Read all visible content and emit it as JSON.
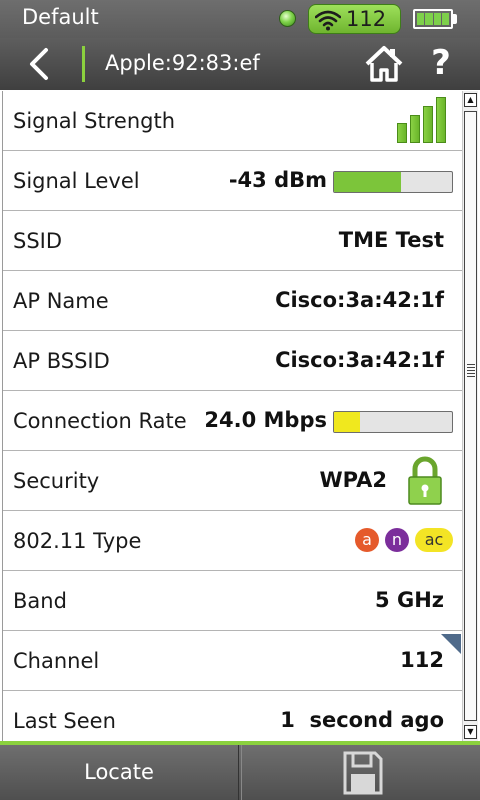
{
  "status_bar": {
    "profile": "Default",
    "wifi_count": "112",
    "battery_segments": 4,
    "led_color": "#7fd34a"
  },
  "header": {
    "title": "Apple:92:83:ef",
    "back_icon": "chevron-left-icon",
    "home_icon": "home-icon",
    "help_label": "?"
  },
  "details": {
    "signal_strength": {
      "label": "Signal Strength",
      "bars_lit": 4,
      "bars_total": 4
    },
    "signal_level": {
      "label": "Signal Level",
      "value": "-43 dBm",
      "meter_fraction": 0.57,
      "meter_color": "#7cc53a"
    },
    "ssid": {
      "label": "SSID",
      "value": "TME Test"
    },
    "ap_name": {
      "label": "AP Name",
      "value": "Cisco:3a:42:1f"
    },
    "ap_bssid": {
      "label": "AP BSSID",
      "value": "Cisco:3a:42:1f"
    },
    "connection_rate": {
      "label": "Connection Rate",
      "value": "24.0 Mbps",
      "meter_fraction": 0.22,
      "meter_color": "#f0e81e"
    },
    "security": {
      "label": "Security",
      "value": "WPA2",
      "icon": "lock-icon"
    },
    "type_80211": {
      "label": "802.11 Type",
      "badges": [
        "a",
        "n",
        "ac"
      ]
    },
    "band": {
      "label": "Band",
      "value": "5 GHz"
    },
    "channel": {
      "label": "Channel",
      "value": "112"
    },
    "last_seen": {
      "label": "Last Seen",
      "value": "1  second ago"
    }
  },
  "bottom_bar": {
    "locate_label": "Locate",
    "save_icon": "save-icon"
  },
  "colors": {
    "accent_green": "#8bd13e",
    "badge_a": "#e55a2b",
    "badge_n": "#7b2e9b",
    "badge_ac": "#f3e425"
  }
}
